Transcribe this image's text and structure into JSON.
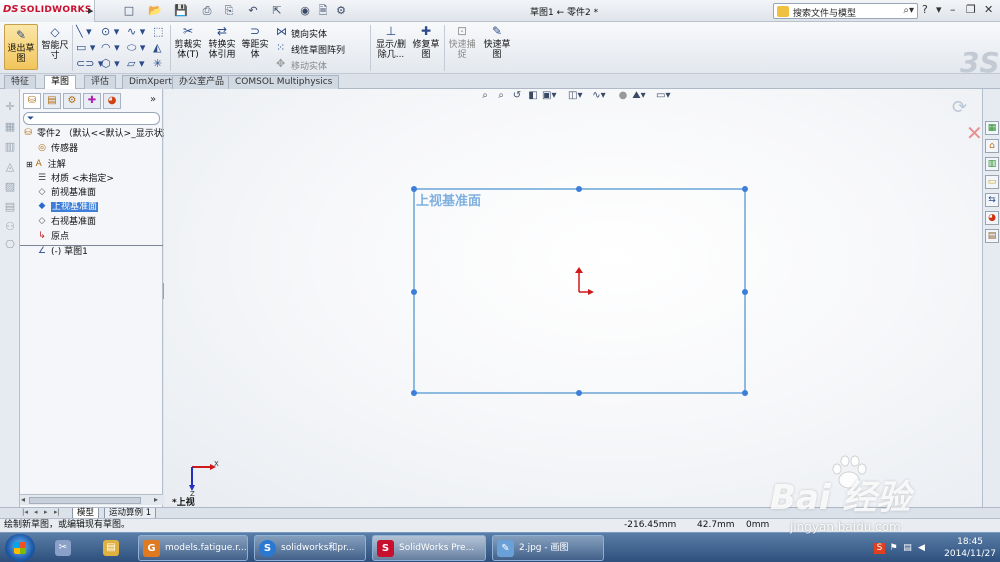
{
  "app": {
    "logo_prefix": "DS",
    "logo_text": "SOLIDWORKS",
    "document_title": "草图1 ← 零件2 *",
    "search_placeholder": "搜索文件与模型"
  },
  "ribbon": {
    "buttons": {
      "exit_sketch": "退出草图",
      "smart_dimension": "智能尺寸",
      "trim_entities": "剪裁实体(T)",
      "convert_entities": "转换实体引用",
      "offset_entities": "等距实体",
      "mirror_entities": "镜向实体",
      "linear_pattern": "线性草图阵列",
      "move_entities": "移动实体",
      "display_delete_relations": "显示/删除几...",
      "repair_sketch": "修复草图",
      "quick_snaps": "快速捕捉",
      "rapid_sketch": "快速草图"
    }
  },
  "tabs": [
    "特征",
    "草图",
    "评估",
    "DimXpert",
    "办公室产品",
    "COMSOL Multiphysics"
  ],
  "active_tab": "草图",
  "feature_tree": {
    "root": "零件2 （默认<<默认>_显示状态",
    "items": [
      {
        "label": "传感器",
        "icon": "sensor-icon"
      },
      {
        "label": "注解",
        "icon": "annotation-icon"
      },
      {
        "label": "材质 <未指定>",
        "icon": "material-icon"
      },
      {
        "label": "前视基准面",
        "icon": "plane-icon"
      },
      {
        "label": "上视基准面",
        "icon": "plane-icon",
        "selected": true
      },
      {
        "label": "右视基准面",
        "icon": "plane-icon"
      },
      {
        "label": "原点",
        "icon": "origin-icon"
      }
    ],
    "sketch": "(-) 草图1"
  },
  "graphics": {
    "plane_label": "上视基准面",
    "view_label": "*上视",
    "triad_axis_x": "X",
    "triad_axis_z": "Z"
  },
  "bottom_tabs": [
    "模型",
    "运动算例 1"
  ],
  "status": {
    "message": "绘制新草图，或编辑现有草图。",
    "x": "-216.45mm",
    "y": "42.7mm",
    "z": "0mm"
  },
  "taskbar": {
    "tasks": [
      "models.fatigue.r...",
      "solidworks和pr...",
      "SolidWorks Pre...",
      "2.jpg - 画图"
    ],
    "time": "18:45",
    "date": "2014/11/27"
  },
  "watermark": {
    "main": "Bai 经验",
    "sub": "jingyan.baidu.com"
  }
}
